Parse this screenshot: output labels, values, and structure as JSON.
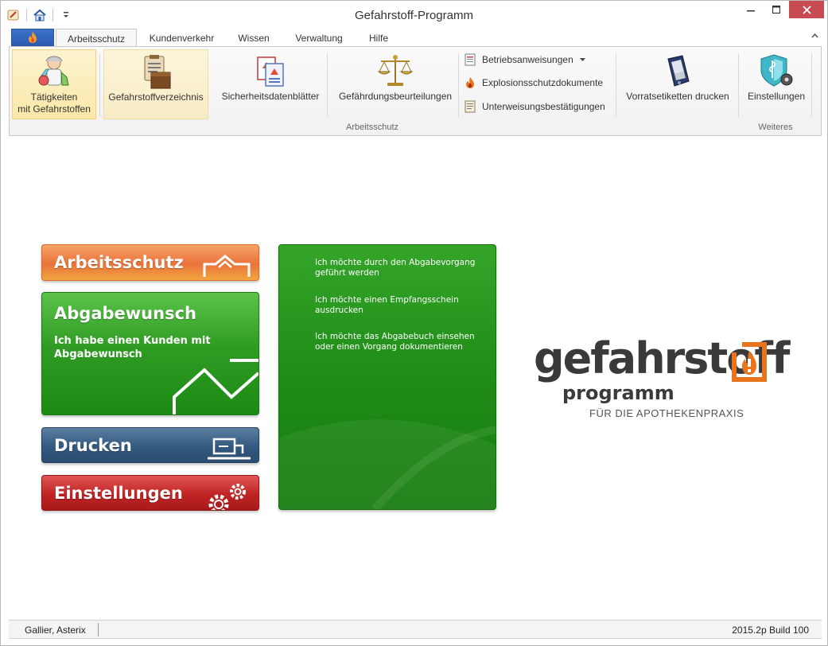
{
  "window": {
    "title": "Gefahrstoff-Programm"
  },
  "tabs": [
    {
      "label": "Arbeitsschutz",
      "active": true
    },
    {
      "label": "Kundenverkehr"
    },
    {
      "label": "Wissen"
    },
    {
      "label": "Verwaltung"
    },
    {
      "label": "Hilfe"
    }
  ],
  "ribbon": {
    "taetigkeiten": [
      "Tätigkeiten",
      "mit Gefahrstoffen"
    ],
    "verzeichnis": "Gefahrstoffverzeichnis",
    "sdb": "Sicherheitsdatenblätter",
    "gefaehrdung": "Gefährdungsbeurteilungen",
    "betriebsanweisungen": "Betriebsanweisungen",
    "explosionsschutz": "Explosionsschutzdokumente",
    "unterweisung": "Unterweisungsbestätigungen",
    "vorrat": "Vorratsetiketten drucken",
    "einstellungen": "Einstellungen",
    "group_arbeitsschutz": "Arbeitsschutz",
    "group_weiteres": "Weiteres"
  },
  "tiles": {
    "arbeitsschutz": "Arbeitsschutz",
    "abgabewunsch_title": "Abgabewunsch",
    "abgabewunsch_sub": [
      "Ich habe einen Kunden mit",
      "Abgabewunsch"
    ],
    "drucken": "Drucken",
    "einstellungen": "Einstellungen"
  },
  "panel": {
    "option1": [
      "Ich möchte durch den Abgabevorgang",
      "geführt werden"
    ],
    "option2": [
      "Ich möchte einen Empfangsschein",
      "ausdrucken"
    ],
    "option3": [
      "Ich möchte das Abgabebuch einsehen",
      "oder einen Vorgang dokumentieren"
    ]
  },
  "logo": {
    "main": "gefahrstoff",
    "sub": "programm",
    "tagline": "FÜR DIE APOTHEKENPRAXIS"
  },
  "status": {
    "user": "Gallier, Asterix",
    "build": "2015.2p Build 100"
  },
  "colors": {
    "orange": "#e9733a",
    "green": "#2f9b23",
    "blue": "#34597f",
    "red": "#c02424",
    "close": "#c74b50"
  }
}
